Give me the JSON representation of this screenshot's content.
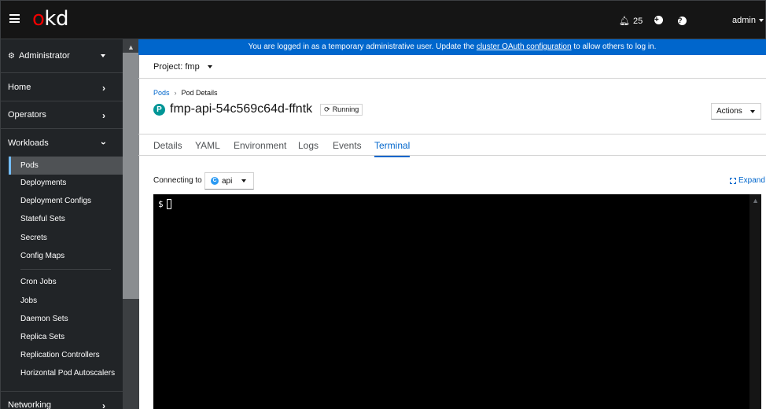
{
  "masthead": {
    "logo_o": "o",
    "logo_rest": "kd",
    "notifications_count": "25",
    "user": "admin"
  },
  "sidebar": {
    "perspective": "Administrator",
    "sections": [
      "Home",
      "Operators",
      "Workloads",
      "Networking"
    ],
    "workloads_items_group1": [
      "Pods",
      "Deployments",
      "Deployment Configs",
      "Stateful Sets",
      "Secrets",
      "Config Maps"
    ],
    "workloads_items_group2": [
      "Cron Jobs",
      "Jobs",
      "Daemon Sets",
      "Replica Sets",
      "Replication Controllers",
      "Horizontal Pod Autoscalers"
    ]
  },
  "banner": {
    "text_before": "You are logged in as a temporary administrative user. Update the ",
    "link": "cluster OAuth configuration",
    "text_after": " to allow others to log in."
  },
  "project": {
    "label": "Project: fmp"
  },
  "breadcrumb": {
    "parent": "Pods",
    "current": "Pod Details"
  },
  "pod": {
    "badge": "P",
    "name": "fmp-api-54c569c64d-ffntk",
    "status": "Running"
  },
  "actions_label": "Actions",
  "tabs": [
    "Details",
    "YAML",
    "Environment",
    "Logs",
    "Events",
    "Terminal"
  ],
  "terminal": {
    "connecting_label": "Connecting to",
    "container_badge": "C",
    "container": "api",
    "expand_label": "Expand",
    "prompt": "$"
  },
  "colors": {
    "accent": "#0066cc",
    "masthead": "#151515",
    "sidebar": "#212427",
    "pod_badge": "#009596",
    "logo_red": "#ee0000"
  }
}
